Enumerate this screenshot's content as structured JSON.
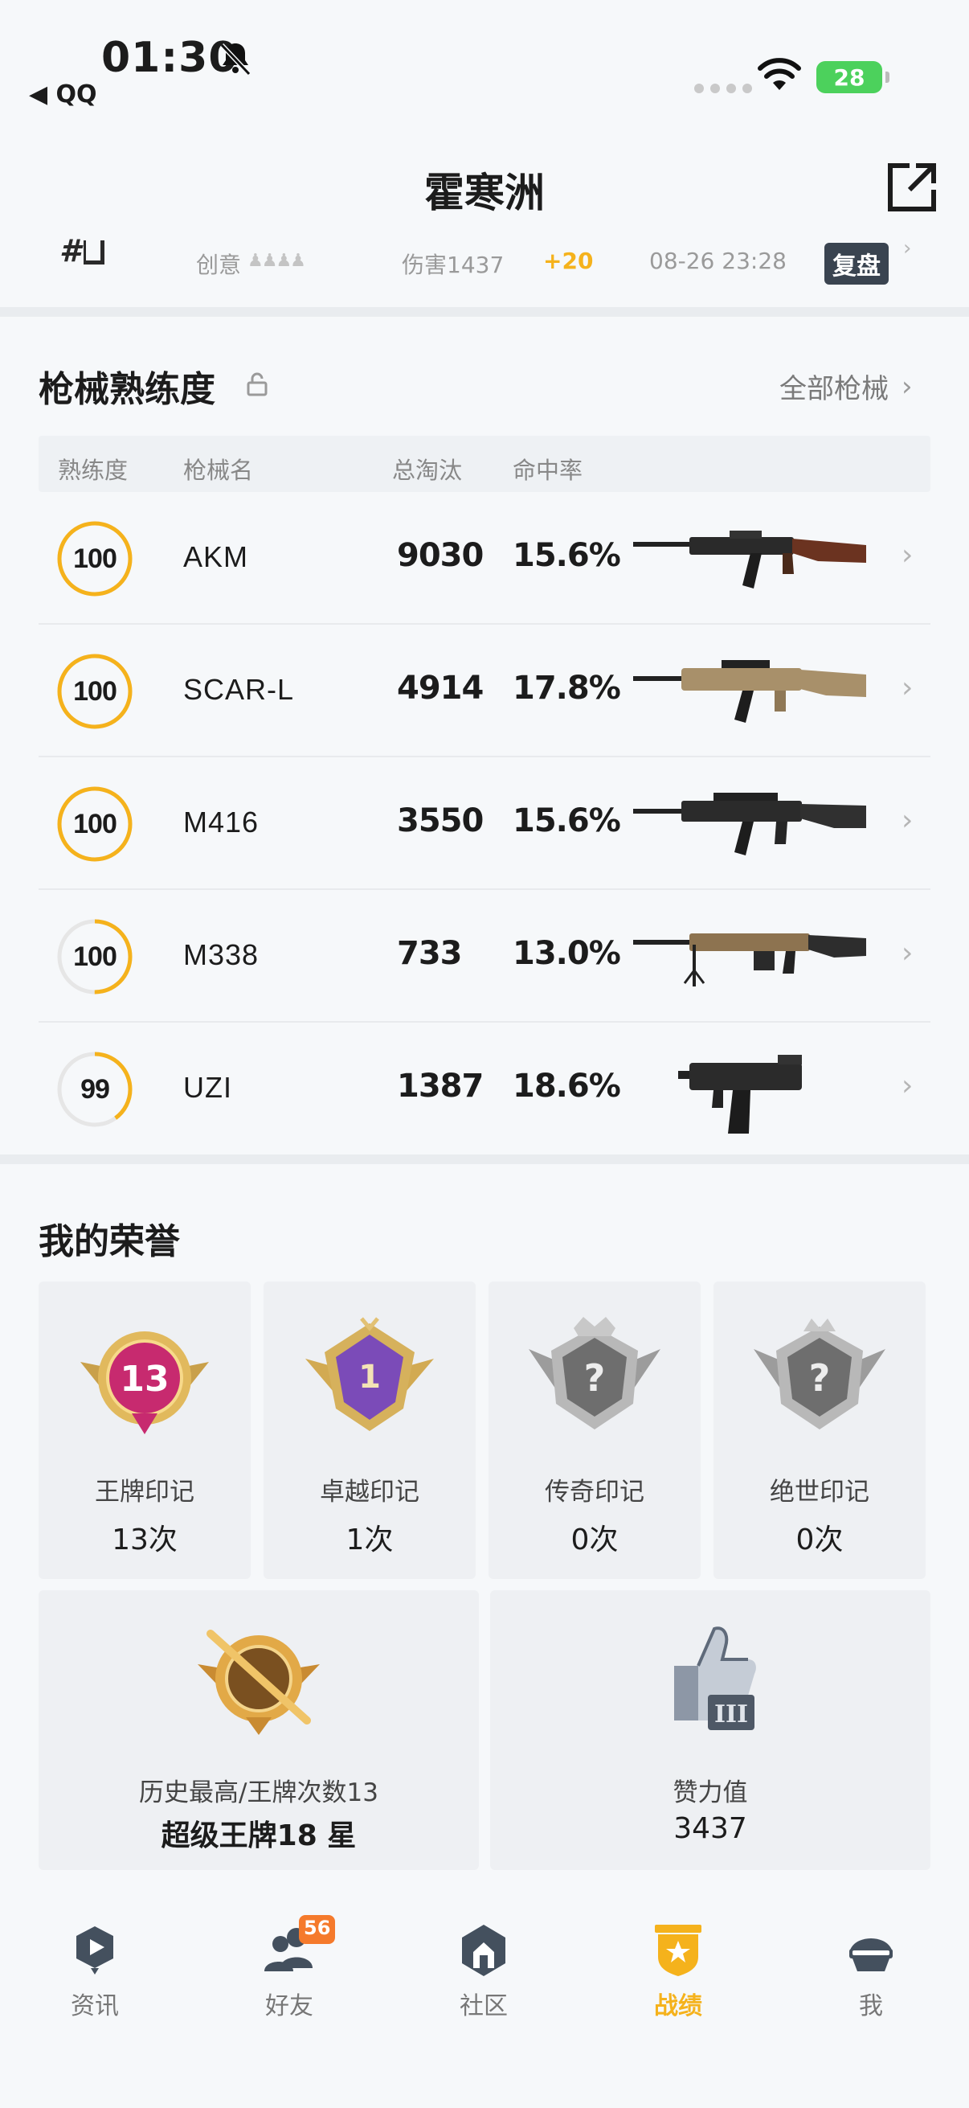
{
  "status_bar": {
    "time": "01:30",
    "back_app": "◀ QQ",
    "battery": "28"
  },
  "header": {
    "title": "霍寒洲"
  },
  "last_match": {
    "rank": "#",
    "mode": "创意",
    "damage": "伤害1437",
    "score_change": "+20",
    "datetime": "08-26 23:28",
    "replay_label": "复盘"
  },
  "weapons": {
    "title": "枪械熟练度",
    "all_link": "全部枪械",
    "columns": [
      "熟练度",
      "枪械名",
      "总淘汰",
      "命中率"
    ],
    "items": [
      {
        "mastery": "100",
        "progress": 1.0,
        "name": "AKM",
        "kills": "9030",
        "hit_rate": "15.6%",
        "weapon_icon": "akm-rifle"
      },
      {
        "mastery": "100",
        "progress": 1.0,
        "name": "SCAR-L",
        "kills": "4914",
        "hit_rate": "17.8%",
        "weapon_icon": "scar-rifle"
      },
      {
        "mastery": "100",
        "progress": 1.0,
        "name": "M416",
        "kills": "3550",
        "hit_rate": "15.6%",
        "weapon_icon": "m416-rifle"
      },
      {
        "mastery": "100",
        "progress": 0.5,
        "name": "M338",
        "kills": "733",
        "hit_rate": "13.0%",
        "weapon_icon": "m338-lmg"
      },
      {
        "mastery": "99",
        "progress": 0.4,
        "name": "UZI",
        "kills": "1387",
        "hit_rate": "18.6%",
        "weapon_icon": "uzi-smg"
      }
    ]
  },
  "honors": {
    "title": "我的荣誉",
    "marks": [
      {
        "label": "王牌印记",
        "value": "13次",
        "badge_text": "13",
        "badge_icon": "ace-badge"
      },
      {
        "label": "卓越印记",
        "value": "1次",
        "badge_text": "1",
        "badge_icon": "excellence-badge"
      },
      {
        "label": "传奇印记",
        "value": "0次",
        "badge_text": "?",
        "badge_icon": "legend-badge-locked"
      },
      {
        "label": "绝世印记",
        "value": "0次",
        "badge_text": "?",
        "badge_icon": "peerless-badge-locked"
      }
    ],
    "history": {
      "label": "历史最高/王牌次数13",
      "value": "超级王牌18 星",
      "badge_icon": "super-ace-badge"
    },
    "likes": {
      "label": "赞力值",
      "value": "3437",
      "badge_icon": "thumbs-up-badge"
    }
  },
  "tabbar": {
    "items": [
      {
        "label": "资讯",
        "icon": "news-icon"
      },
      {
        "label": "好友",
        "icon": "friends-icon",
        "badge": "56"
      },
      {
        "label": "社区",
        "icon": "community-icon"
      },
      {
        "label": "战绩",
        "icon": "stats-icon",
        "active": true
      },
      {
        "label": "我",
        "icon": "profile-helmet-icon"
      }
    ]
  },
  "colors": {
    "accent": "#f5b21c",
    "badge": "#f57a2c",
    "card": "#eef0f3"
  }
}
